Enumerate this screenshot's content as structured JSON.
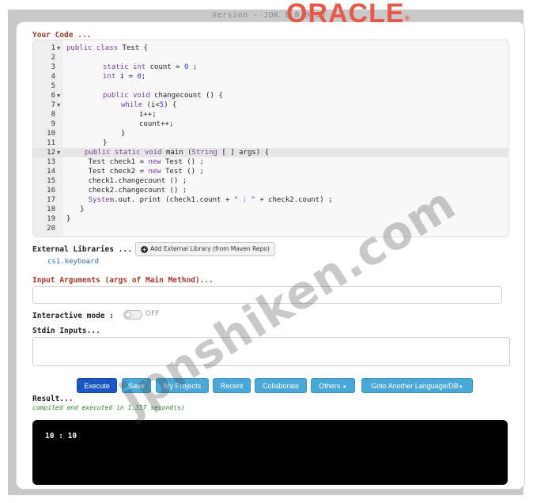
{
  "header": {
    "version": "Version - JDK 1.8.0_66",
    "brand": "ORACLE",
    "brand_mark": "®"
  },
  "labels": {
    "your_code": "Your Code ...",
    "external_libraries": "External Libraries ...",
    "add_library": "Add External Library (from Maven Repo)",
    "input_arguments": "Input Arguments (args of Main Method)...",
    "interactive_mode": "Interactive mode :",
    "toggle_state": "OFF",
    "stdin_inputs": "Stdin Inputs...",
    "result": "Result...",
    "result_status": "compiled and executed in 1.357 second(s)"
  },
  "libraries": [
    "cs1.keyboard"
  ],
  "editor": {
    "active_line": 12,
    "lines": [
      {
        "n": "1",
        "fold": true,
        "indent": 0,
        "tokens": [
          [
            "kw",
            "public"
          ],
          [
            "t",
            " "
          ],
          [
            "kw",
            "class"
          ],
          [
            "t",
            " Test {"
          ]
        ]
      },
      {
        "n": "2",
        "fold": false,
        "indent": 0,
        "tokens": []
      },
      {
        "n": "3",
        "fold": false,
        "indent": 2,
        "tokens": [
          [
            "kw",
            "static"
          ],
          [
            "t",
            " "
          ],
          [
            "ty",
            "int"
          ],
          [
            "t",
            " count = "
          ],
          [
            "num",
            "0"
          ],
          [
            "t",
            " ;"
          ]
        ]
      },
      {
        "n": "4",
        "fold": false,
        "indent": 2,
        "tokens": [
          [
            "ty",
            "int"
          ],
          [
            "t",
            " i = "
          ],
          [
            "num",
            "0"
          ],
          [
            "t",
            ";"
          ]
        ]
      },
      {
        "n": "5",
        "fold": false,
        "indent": 0,
        "tokens": []
      },
      {
        "n": "6",
        "fold": true,
        "indent": 2,
        "tokens": [
          [
            "kw",
            "public"
          ],
          [
            "t",
            " "
          ],
          [
            "kw",
            "void"
          ],
          [
            "t",
            " changecount () {"
          ]
        ]
      },
      {
        "n": "7",
        "fold": true,
        "indent": 3,
        "tokens": [
          [
            "kw",
            "while"
          ],
          [
            "t",
            " (i<"
          ],
          [
            "num",
            "5"
          ],
          [
            "t",
            ") {"
          ]
        ]
      },
      {
        "n": "8",
        "fold": false,
        "indent": 4,
        "tokens": [
          [
            "t",
            "i++;"
          ]
        ]
      },
      {
        "n": "9",
        "fold": false,
        "indent": 4,
        "tokens": [
          [
            "t",
            "count++;"
          ]
        ]
      },
      {
        "n": "10",
        "fold": false,
        "indent": 3,
        "tokens": [
          [
            "t",
            "}"
          ]
        ]
      },
      {
        "n": "11",
        "fold": false,
        "indent": 2,
        "tokens": [
          [
            "t",
            "}"
          ]
        ]
      },
      {
        "n": "12",
        "fold": true,
        "indent": 1,
        "tokens": [
          [
            "kw",
            "public"
          ],
          [
            "t",
            " "
          ],
          [
            "kw",
            "static"
          ],
          [
            "t",
            " "
          ],
          [
            "kw",
            "void"
          ],
          [
            "t",
            " main ("
          ],
          [
            "ty",
            "String"
          ],
          [
            "t",
            " [ ] args) {"
          ]
        ]
      },
      {
        "n": "13",
        "fold": false,
        "indent": 1.2,
        "tokens": [
          [
            "t",
            "Test check1 = "
          ],
          [
            "kw",
            "new"
          ],
          [
            "t",
            " Test () ;"
          ]
        ]
      },
      {
        "n": "14",
        "fold": false,
        "indent": 1.2,
        "tokens": [
          [
            "t",
            "Test check2 = "
          ],
          [
            "kw",
            "new"
          ],
          [
            "t",
            " Test () ;"
          ]
        ]
      },
      {
        "n": "15",
        "fold": false,
        "indent": 1.2,
        "tokens": [
          [
            "t",
            "check1.changecount () ;"
          ]
        ]
      },
      {
        "n": "16",
        "fold": false,
        "indent": 1.2,
        "tokens": [
          [
            "t",
            "check2.changecount () ;"
          ]
        ]
      },
      {
        "n": "17",
        "fold": false,
        "indent": 1.2,
        "tokens": [
          [
            "ty",
            "System"
          ],
          [
            "t",
            ".out. print (check1.count + "
          ],
          [
            "num",
            "\" : \""
          ],
          [
            "t",
            " + check2.count) ;"
          ]
        ]
      },
      {
        "n": "18",
        "fold": false,
        "indent": 0.75,
        "tokens": [
          [
            "t",
            "}"
          ]
        ]
      },
      {
        "n": "19",
        "fold": false,
        "indent": 0,
        "tokens": [
          [
            "t",
            "}"
          ]
        ]
      },
      {
        "n": "20",
        "fold": false,
        "indent": 0,
        "tokens": []
      }
    ]
  },
  "toolbar": {
    "execute": "Execute",
    "save": "Save",
    "my_projects": "My Projects",
    "recent": "Recent",
    "collaborate": "Collaborate",
    "others": "Others",
    "goto_language": "Goto Another Language/DB"
  },
  "console": {
    "output": "10 : 10"
  },
  "watermark": "jpnshiken.com"
}
